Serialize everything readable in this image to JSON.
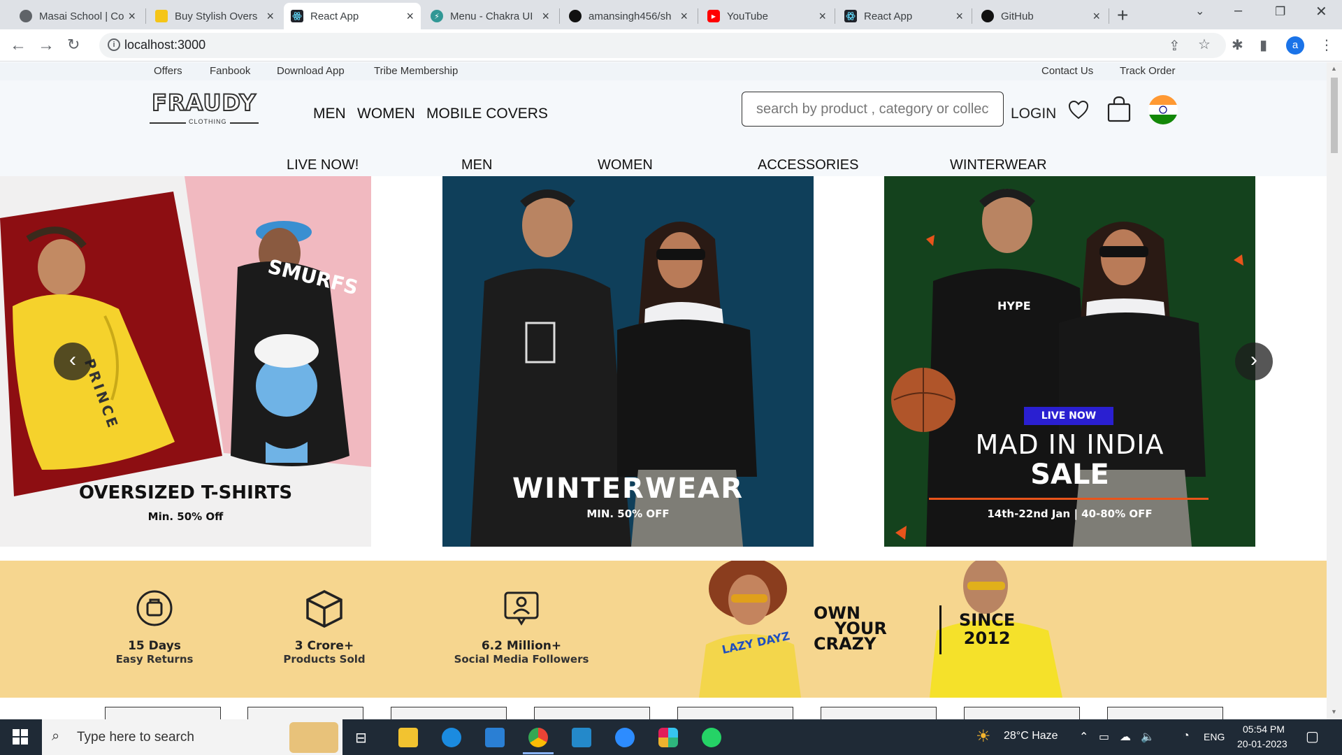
{
  "browser": {
    "tabs": [
      {
        "title": "Masai School | Co",
        "active": false
      },
      {
        "title": "Buy Stylish Overs",
        "active": false
      },
      {
        "title": "React App",
        "active": true
      },
      {
        "title": "Menu - Chakra UI",
        "active": false
      },
      {
        "title": "amansingh456/sh",
        "active": false
      },
      {
        "title": "YouTube",
        "active": false
      },
      {
        "title": "React App",
        "active": false
      },
      {
        "title": "GitHub",
        "active": false
      }
    ],
    "url": "localhost:3000",
    "profile_initial": "a"
  },
  "site": {
    "top_links_left": [
      "Offers",
      "Fanbook",
      "Download App",
      "Tribe Membership"
    ],
    "top_links_right": [
      "Contact Us",
      "Track Order"
    ],
    "logo_text": "FRAUDY",
    "logo_sub": "CLOTHING",
    "main_nav": [
      "MEN",
      "WOMEN",
      "MOBILE COVERS"
    ],
    "search_placeholder": "search by product , category or collection",
    "login_label": "LOGIN",
    "category_nav": [
      "LIVE NOW!",
      "MEN",
      "WOMEN",
      "ACCESSORIES",
      "WINTERWEAR"
    ],
    "slides": [
      {
        "title": "OVERSIZED T-SHIRTS",
        "subtitle": "Min. 50% Off",
        "shirt_text": "SMURFS",
        "tee_text": "PRINCE"
      },
      {
        "title": "WINTERWEAR",
        "subtitle": "MIN. 50% OFF"
      },
      {
        "badge": "LIVE NOW",
        "title_line1": "MAD IN INDIA",
        "title_line2": "SALE",
        "dates": "14th-22nd Jan  |  40-80% OFF",
        "hoodie_text": "HYPE"
      }
    ],
    "usp": [
      {
        "value": "15 Days",
        "label": "Easy Returns"
      },
      {
        "value": "3 Crore+",
        "label": "Products Sold"
      },
      {
        "value": "6.2 Million+",
        "label": "Social Media Followers"
      }
    ],
    "tagline_lines": [
      "OWN",
      "YOUR",
      "CRAZY"
    ],
    "since_lines": [
      "SINCE",
      "2012"
    ],
    "tee_print": "LAZY DAYZ"
  },
  "taskbar": {
    "search_placeholder": "Type here to search",
    "weather": "28°C  Haze",
    "lang": "ENG",
    "time": "05:54 PM",
    "date": "20-01-2023"
  },
  "colors": {
    "usp_bg": "#f6d68f",
    "slide2_bg": "#0f3f5a",
    "slide3_bg": "#14421d",
    "live_badge": "#2a1fd1"
  }
}
